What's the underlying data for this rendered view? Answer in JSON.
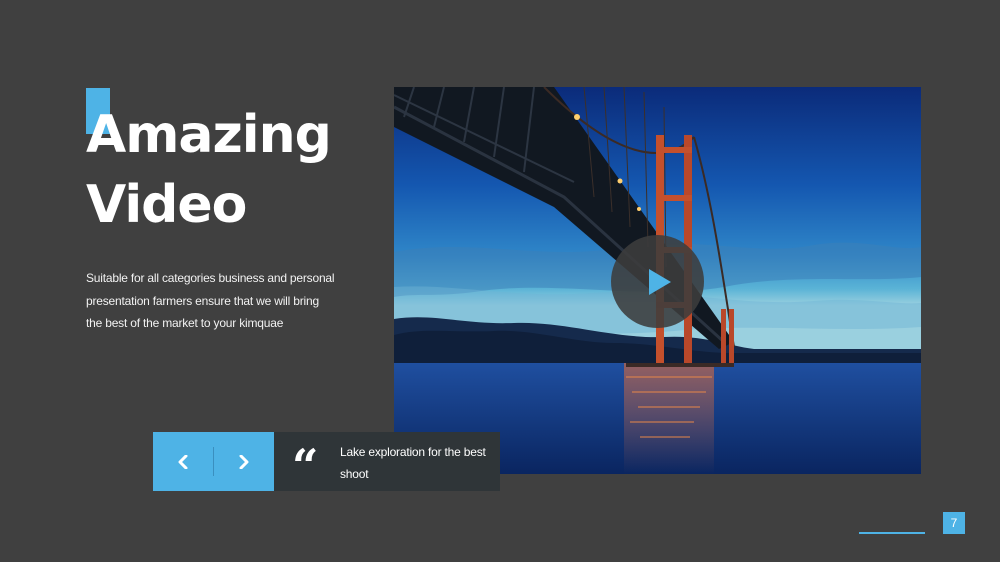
{
  "slide": {
    "title_line1": "Amazing",
    "title_line2": "Video",
    "body": "Suitable for all categories business and personal presentation farmers ensure that we will bring the best of the market to your kimquae",
    "quote_mark": "“",
    "quote_text": "Lake exploration for the best shoot",
    "page_number": "7"
  },
  "icons": {
    "play": "play-icon",
    "prev": "chevron-left-icon",
    "next": "chevron-right-icon",
    "quote": "quote-icon"
  },
  "colors": {
    "background": "#404040",
    "accent": "#4eb3e6",
    "quote_panel": "#2f3538",
    "text": "#ffffff"
  }
}
